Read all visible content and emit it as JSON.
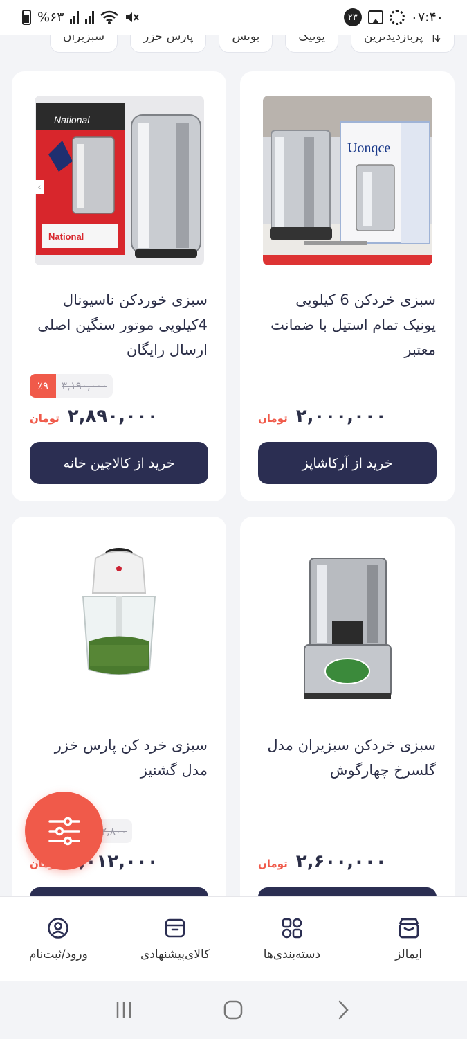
{
  "status_bar": {
    "battery": "%۶۳",
    "time": "۰۷:۴۰",
    "notification_count": "۲۳"
  },
  "filter_chips": [
    {
      "label": "پربازدیدترین",
      "icon": "sort-icon"
    },
    {
      "label": "یونیک"
    },
    {
      "label": "بوتس"
    },
    {
      "label": "پارس خزر"
    },
    {
      "label": "سبزیران"
    }
  ],
  "products": [
    {
      "title": "سبزی خردکن 6 کیلویی یونیک تمام استیل با ضمانت معتبر",
      "price": "۲,۰۰۰,۰۰۰",
      "currency": "تومان",
      "old_price": "",
      "discount": "",
      "button_label": "خرید از آرکاشاپز",
      "image": "stainless-vegetable-chopper-with-box"
    },
    {
      "title": "سبزی خوردکن ناسیونال 4کیلویی موتور سنگین اصلی ارسال رایگان",
      "price": "۲,۸۹۰,۰۰۰",
      "currency": "تومان",
      "old_price": "۳,۱۹۰,۰۰۰",
      "discount": "٪۹",
      "button_label": "خرید از کالاچین خانه",
      "image": "national-vegetable-chopper-with-box"
    },
    {
      "title": "سبزی خردکن سبزیران مدل گلسرخ چهارگوش",
      "price": "۲,۶۰۰,۰۰۰",
      "currency": "تومان",
      "old_price": "",
      "discount": "",
      "button_label": "",
      "image": "sabziran-square-chopper"
    },
    {
      "title": "سبزی خرد کن پارس خزر مدل گشنیز",
      "price": "۲,۰۱۲,۰۰۰",
      "currency": "تومان",
      "old_price": "۲,۸۰۰",
      "discount": "",
      "button_label": "",
      "image": "pars-khazar-chopper-bowl"
    }
  ],
  "bottom_nav": [
    {
      "label": "ایمالز",
      "icon": "store-icon"
    },
    {
      "label": "دسته‌بندی‌ها",
      "icon": "categories-icon"
    },
    {
      "label": "کالای‌پیشنهادی",
      "icon": "offer-box-icon"
    },
    {
      "label": "ورود/ثبت‌نام",
      "icon": "user-icon"
    }
  ],
  "colors": {
    "accent": "#f05a4a",
    "primary_button": "#2b2e52",
    "background": "#f3f4f7"
  }
}
